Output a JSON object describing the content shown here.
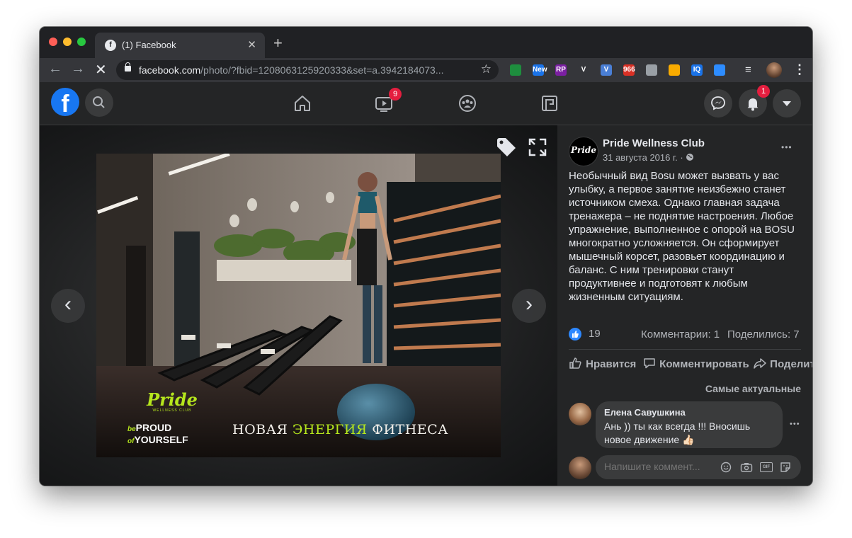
{
  "browser": {
    "tab_title": "(1) Facebook",
    "tab_favicon": "facebook-favicon",
    "url_host": "facebook.com",
    "url_path": "/photo/?fbid=1208063125920333&set=a.3942184073...",
    "new_tab_symbol": "+",
    "close_symbol": "✕",
    "extensions": [
      {
        "name": "screenshot-ext-icon",
        "label": "",
        "color": "#1e8e3e"
      },
      {
        "name": "rainbow-ext-icon",
        "label": "New",
        "color": "#1a73e8"
      },
      {
        "name": "rp-ext-icon",
        "label": "RP",
        "color": "#7b1fa2"
      },
      {
        "name": "v-ext-icon",
        "label": "V",
        "color": "#35363a"
      },
      {
        "name": "v-blue-ext-icon",
        "label": "V",
        "color": "#4a7fd6"
      },
      {
        "name": "mail-ext-icon",
        "label": "966",
        "color": "#d93025"
      },
      {
        "name": "inbox-ext-icon",
        "label": "",
        "color": "#9aa0a6"
      },
      {
        "name": "bookmark-ext-icon",
        "label": "",
        "color": "#f9ab00"
      },
      {
        "name": "iq-ext-icon",
        "label": "IQ",
        "color": "#1a73e8"
      },
      {
        "name": "zoom-ext-icon",
        "label": "",
        "color": "#2d8cff"
      }
    ]
  },
  "fb": {
    "logo": "f",
    "watch_badge": "9",
    "notifications_badge": "1"
  },
  "photo": {
    "brand_line1": "Pride",
    "brand_line2": "WELLNESS CLUB",
    "slogan_be": "be",
    "slogan_proud": "PROUD",
    "slogan_of": "of",
    "slogan_yourself": "YOURSELF",
    "caption_part1": "НОВАЯ ",
    "caption_accent": "ЭНЕРГИЯ",
    "caption_part2": " ФИТНЕСА"
  },
  "post": {
    "page_name": "Pride Wellness Club",
    "avatar_text": "Pride",
    "date": "31 августа 2016 г. · ",
    "more": "•••",
    "body": "Необычный вид Bosu может вызвать у вас улыбку, а первое занятие неизбежно станет источником смеха. Однако главная задача тренажера – не поднятие настроения. Любое упражнение, выполненное с опорой на BOSU многократно усложняется. Он сформирует мышечный корсет, разовьет координацию и баланс. С ним тренировки станут продуктивнее и подготовят к любым жизненным ситуациям.",
    "likes": "19",
    "comments_count": "Комментарии: 1",
    "shares_count": "Поделились: 7",
    "like_action": "Нравится",
    "comment_action": "Комментировать",
    "share_action": "Поделиться",
    "sort_label": "Самые актуальные"
  },
  "comment": {
    "author": "Елена Савушкина",
    "text": "Ань )) ты как всегда !!! Вносишь новое движение 👍🏻",
    "more": "•••"
  },
  "composer": {
    "placeholder": "Напишите коммент...",
    "gif_label": "GIF"
  }
}
